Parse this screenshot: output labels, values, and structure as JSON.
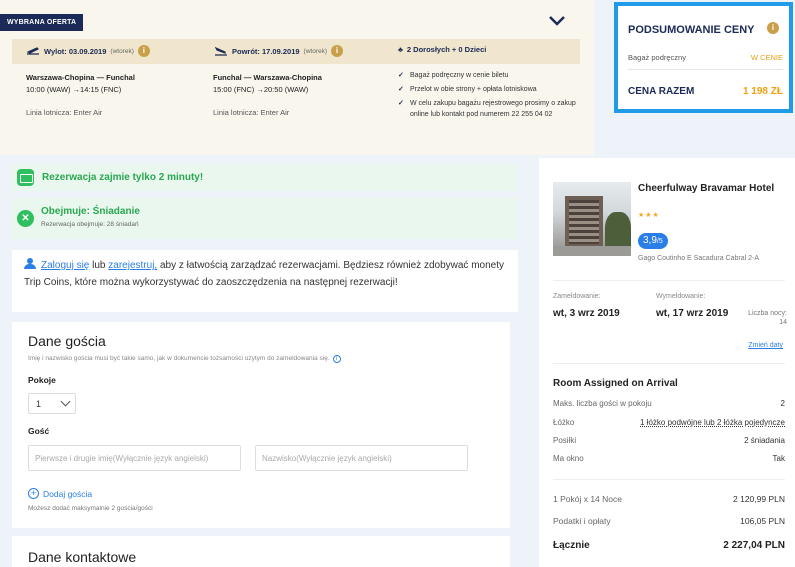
{
  "offer": {
    "tag": "WYBRANA OFERTA",
    "outbound": {
      "label": "Wylot: 03.09.2019",
      "weekday": "(wtorek)",
      "route": "Warszawa-Chopina — Funchal",
      "times": "10:00 (WAW) →14:15 (FNC)",
      "airline": "Linia lotnicza: Enter Air"
    },
    "inbound": {
      "label": "Powrót: 17.09.2019",
      "weekday": "(wtorek)",
      "route": "Funchal — Warszawa-Chopina",
      "times": "15:00 (FNC) →20:50 (WAW)",
      "airline": "Linia lotnicza: Enter Air"
    },
    "passengers": "2 Dorosłych + 0 Dzieci",
    "baggage": [
      "Bagaż podręczny w cenie biletu",
      "Przelot w obie strony + opłata lotniskowa",
      "W celu zakupu bagażu rejestrowego prosimy o zakup online lub kontakt pod numerem 22 255 04 02"
    ]
  },
  "summary": {
    "title": "PODSUMOWANIE CENY",
    "baggage_label": "Bagaż podręczny",
    "baggage_value": "W CENIE",
    "total_label": "CENA RAZEM",
    "total_value": "1 198 ZŁ"
  },
  "banners": {
    "quick": "Rezerwacja zajmie tylko 2 minuty!",
    "meal_title": "Obejmuje: Śniadanie",
    "meal_sub": "Rezerwacja obejmuje: 28 śniadań"
  },
  "login": {
    "login_link": "Zaloguj się",
    "or": "lub",
    "register_link": "zarejestruj,",
    "text": "aby z łatwością zarządzać rezerwacjami. Będziesz również zdobywać monety Trip Coins, które można wykorzystywać do zaoszczędzenia na następnej rezerwacji!"
  },
  "guest": {
    "title": "Dane gościa",
    "note": "Imię i nazwisko gościa musi być takie samo, jak w dokumencie tożsamości użytym do zameldowania się.",
    "rooms_label": "Pokoje",
    "rooms_value": "1",
    "guest_label": "Gość",
    "first_name_placeholder": "Pierwsze i drugie imię(Wyłącznie język angielski)",
    "last_name_placeholder": "Nazwisko(Wyłącznie język angielski)",
    "add_guest": "Dodaj gościa",
    "add_note": "Możesz dodać maksymalnie 2 gościa/gości"
  },
  "contact": {
    "title": "Dane kontaktowe"
  },
  "hotel": {
    "name": "Cheerfulway Bravamar Hotel",
    "stars": "★★★",
    "rating": "3,9",
    "rating_of": "/5",
    "address": "Gago Coutinho E Sacadura Cabral 2-A",
    "checkin_label": "Zameldowanie:",
    "checkin_value": "wt, 3 wrz 2019",
    "checkout_label": "Wymeldowanie:",
    "checkout_value": "wt, 17 wrz 2019",
    "nights_label": "Liczba nocy:",
    "nights_value": "14",
    "change_dates": "Zmień daty",
    "room_title": "Room Assigned on Arrival",
    "room_rows": [
      {
        "k": "Maks. liczba gości w pokoju",
        "v": "2"
      },
      {
        "k": "Łóżko",
        "v": "1 łóżko podwójne lub 2 łóżka pojedyncze"
      },
      {
        "k": "Posiłki",
        "v": "2 śniadania"
      },
      {
        "k": "Ma okno",
        "v": "Tak"
      }
    ],
    "price_rows": [
      {
        "k": "1 Pokój x 14 Noce",
        "v": "2 120,99 PLN"
      },
      {
        "k": "Podatki i opłaty",
        "v": "106,05 PLN"
      }
    ],
    "total_label": "Łącznie",
    "total_value": "2 227,04 PLN"
  },
  "colors": {
    "navy": "#1b2a56",
    "blue": "#1f9be8",
    "link": "#2a7ee8",
    "green": "#29a850",
    "orange": "#f0a010"
  }
}
